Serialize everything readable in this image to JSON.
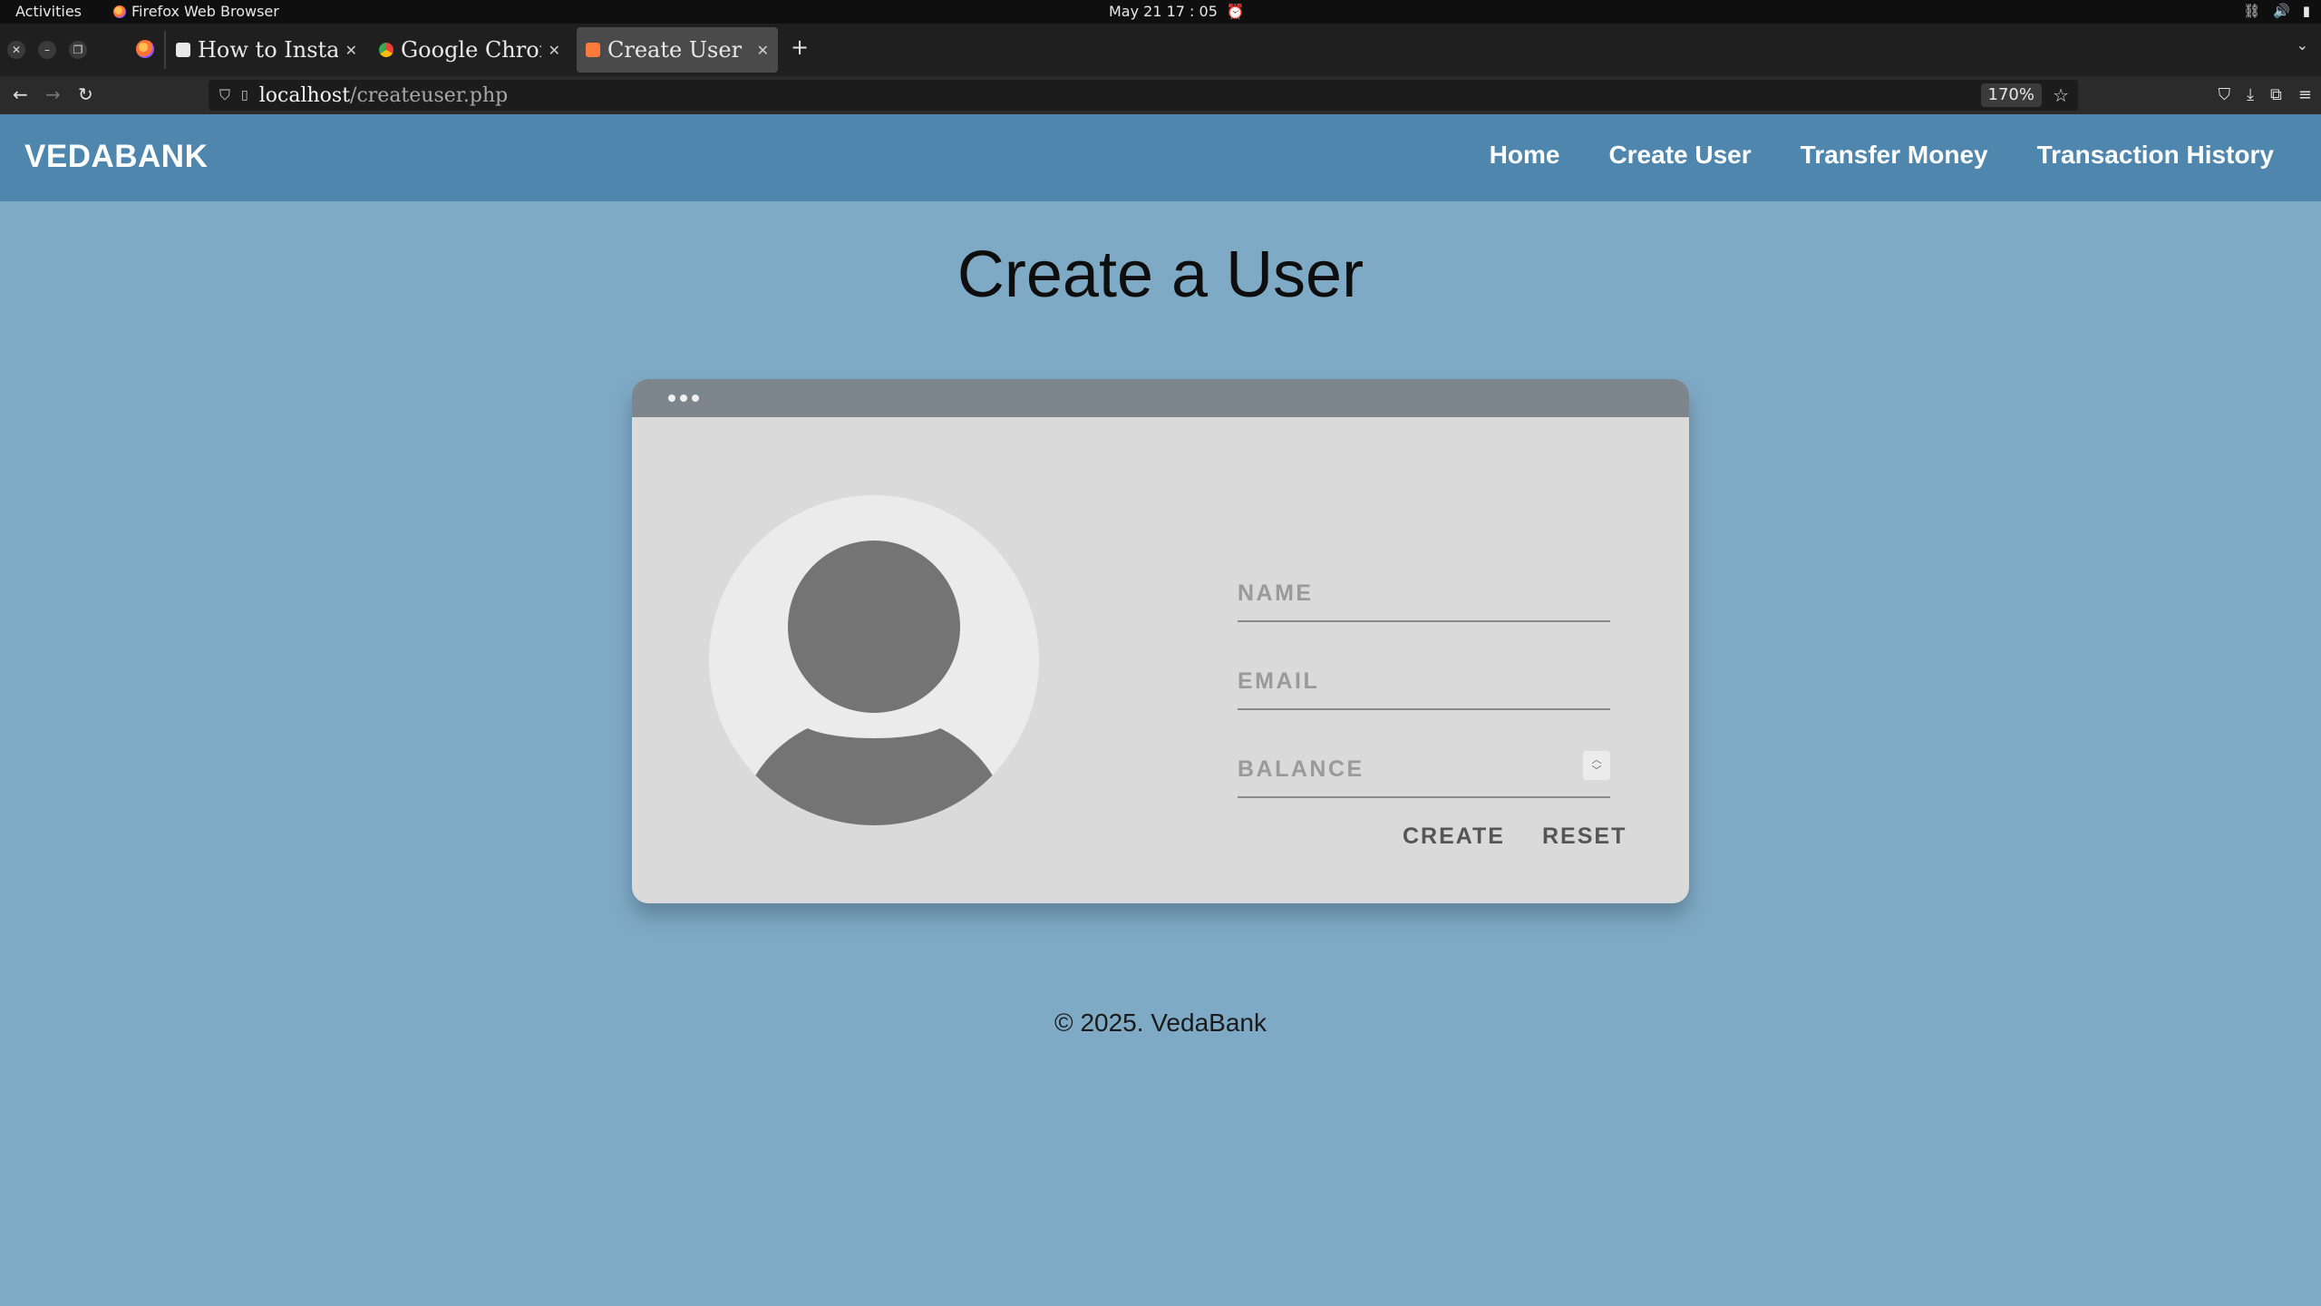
{
  "system": {
    "activities": "Activities",
    "app_name": "Firefox Web Browser",
    "clock": "May 21  17 : 05"
  },
  "browser": {
    "tabs": [
      {
        "label": "How to Install Chrome",
        "favicon_color": "#e8e8e8"
      },
      {
        "label": "Google Chrome",
        "favicon_color": "#4285f4"
      },
      {
        "label": "Create User",
        "favicon_color": "#ff7b3b"
      }
    ],
    "url_host": "localhost",
    "url_path": "/createuser.php",
    "zoom": "170%"
  },
  "site": {
    "brand": "VEDABANK",
    "nav": [
      {
        "label": "Home"
      },
      {
        "label": "Create User"
      },
      {
        "label": "Transfer Money"
      },
      {
        "label": "Transaction History"
      }
    ],
    "title": "Create a User",
    "form": {
      "name_placeholder": "NAME",
      "email_placeholder": "EMAIL",
      "balance_placeholder": "BALANCE",
      "create_label": "CREATE",
      "reset_label": "RESET"
    },
    "footer": "© 2025. VedaBank"
  },
  "colors": {
    "header": "#4e86ad",
    "background": "#7faac6",
    "card": "#dadada",
    "card_top": "#7c868c"
  }
}
